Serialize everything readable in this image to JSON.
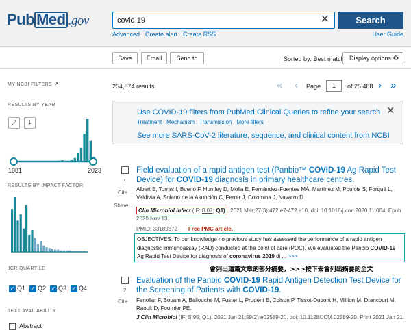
{
  "header": {
    "logo_pub": "Pub",
    "logo_med": "Med",
    "logo_gov": ".gov",
    "search_value": "covid 19",
    "search_button": "Search",
    "links": [
      "Advanced",
      "Create alert",
      "Create RSS"
    ],
    "user_guide": "User Guide"
  },
  "toolbar": {
    "save": "Save",
    "email": "Email",
    "send_to": "Send to",
    "sorted_by": "Sorted by: Best match",
    "display_options": "Display options"
  },
  "sidebar": {
    "my_filters": "MY NCBI FILTERS",
    "results_by_year": "RESULTS BY YEAR",
    "year_start": "1981",
    "year_end": "2023",
    "results_by_if": "RESULTS BY IMPACT FACTOR",
    "jcr_quartile": "JCR QUARTILE",
    "quartiles": [
      "Q1",
      "Q2",
      "Q3",
      "Q4"
    ],
    "text_availability": "TEXT AVAILABILITY",
    "abstract_label": "Abstract"
  },
  "results": {
    "count": "254,874 results",
    "page_label": "Page",
    "page_value": "1",
    "page_total": "of 25,488"
  },
  "notice": {
    "line1": "Use COVID-19 filters from PubMed Clinical Queries to refine your search",
    "links": [
      "Treatment",
      "Mechanism",
      "Transmission",
      "More filters"
    ],
    "line2": "See more SARS-CoV-2 literature, sequence, and clinical content from NCBI"
  },
  "article1": {
    "num": "1",
    "cite": "Cite",
    "share": "Share",
    "title_a": "Field evaluation of a rapid antigen test (Panbio™ ",
    "title_b": "COVID-19",
    "title_c": " Ag Rapid Test Device) for ",
    "title_d": "COVID-19",
    "title_e": " diagnosis in primary healthcare centres.",
    "authors": "Albert E, Torres I, Bueno F, Huntley D, Molla E, Fernández-Fuentes MÁ, Martínez M, Poujois S, Forqué L, Valdivia A, Solano de la Asunción C, Ferrer J, Colomina J, Navarro D.",
    "journal": "Clin Microbiol Infect",
    "if_text": " (IF: ",
    "if_value": "8.07",
    "q_text": "; Q1)",
    "cite_rest": ". 2021 Mar;27(3):472.e7-472.e10. doi: 10.1016/j.cmi.2020.11.004. Epub 2020 Nov 13.",
    "pmid": "PMID: 33189872",
    "free_pmc": "Free PMC article.",
    "abstract_a": "OBJECTIVES: To our knowledge no previous study has assessed the performance of a rapid antigen diagnostic immunoassay (RAD) conducted at the point of care (POC). We evaluated the Panbio ",
    "abstract_b": "COVID-19",
    "abstract_c": " Ag Rapid Test Device for diagnosis of ",
    "abstract_d": "coronavirus 2019",
    "abstract_e": " di ...",
    "abstract_more": " >>>"
  },
  "annotation": "會列出這篇文章的部分摘要，>>>按下去會列出摘要的全文",
  "article2": {
    "num": "2",
    "cite": "Cite",
    "title_a": "Evaluation of the Panbio ",
    "title_b": "COVID-19",
    "title_c": " Rapid Antigen Detection Test Device for the Screening of Patients with ",
    "title_d": "COVID-19",
    "title_e": ".",
    "authors": "Fenollar F, Bouam A, Ballouche M, Fuster L, Prudent E, Colson P, Tissot-Dupont H, Million M, Drancourt M, Raoult D, Fournier PE.",
    "journal": "J Clin Microbiol",
    "if_text": " (IF: ",
    "if_value": "5.95",
    "q_text": "; Q1)",
    "cite_rest": ". 2021 Jan 21;59(2):e02589-20. doi: 10.1128/JCM.02589-20. Print 2021 Jan 21."
  },
  "chart_data": [
    {
      "type": "bar",
      "name_hint": "results-by-year",
      "categories": [
        "1981",
        "2023"
      ],
      "values": [
        1,
        2,
        3,
        1,
        2,
        4,
        8,
        18,
        30,
        60,
        92,
        45,
        10
      ],
      "xlabel": "",
      "ylabel": ""
    },
    {
      "type": "bar",
      "name_hint": "results-by-impact-factor",
      "values": [
        55,
        70,
        40,
        48,
        30,
        60,
        22,
        28,
        18,
        10,
        14,
        8,
        6,
        5,
        4,
        3,
        3,
        2,
        2,
        2,
        2,
        1,
        1,
        1,
        1,
        1
      ],
      "xlabel": "",
      "ylabel": ""
    }
  ]
}
